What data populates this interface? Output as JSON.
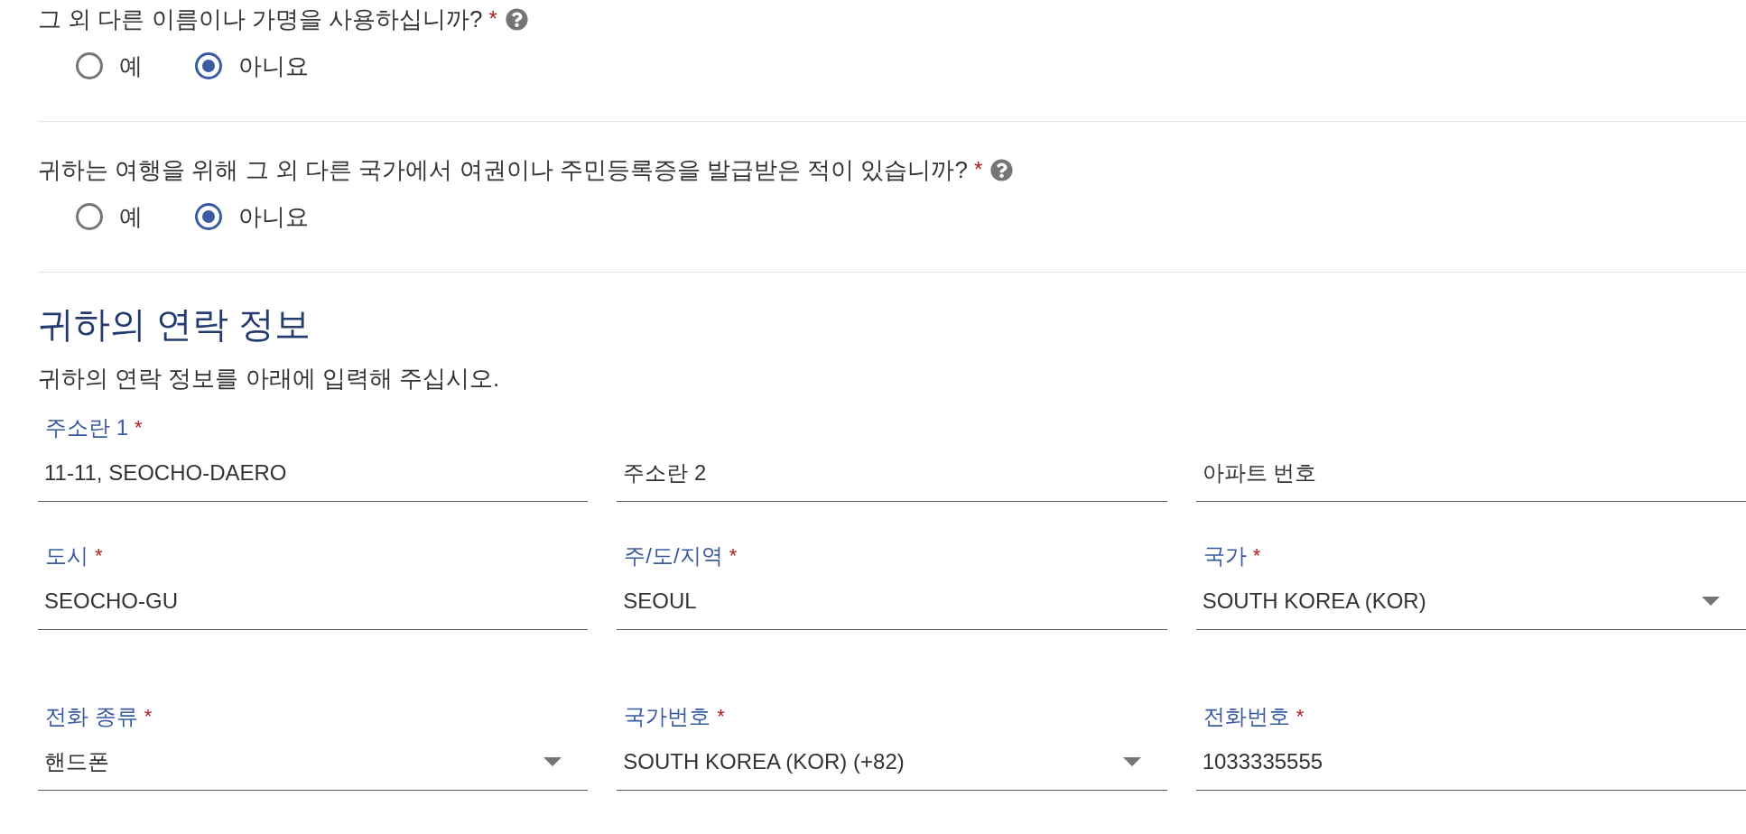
{
  "questions": [
    {
      "text": "그 외 다른 이름이나 가명을 사용하십니까?",
      "required_mark": "*",
      "options": [
        {
          "label": "예",
          "selected": false
        },
        {
          "label": "아니요",
          "selected": true
        }
      ]
    },
    {
      "text": "귀하는 여행을 위해 그 외 다른 국가에서 여권이나 주민등록증을 발급받은 적이 있습니까?",
      "required_mark": "*",
      "options": [
        {
          "label": "예",
          "selected": false
        },
        {
          "label": "아니요",
          "selected": true
        }
      ]
    }
  ],
  "contact_section": {
    "title": "귀하의 연락 정보",
    "description": "귀하의 연락 정보를 아래에 입력해 주십시오.",
    "field_groups": [
      {
        "rows": [
          [
            {
              "kind": "text",
              "label": "주소란 1",
              "required_mark": "*",
              "value": "11-11, SEOCHO-DAERO"
            },
            {
              "kind": "text",
              "placeholder": "주소란 2"
            },
            {
              "kind": "text",
              "placeholder": "아파트 번호"
            }
          ],
          [
            {
              "kind": "text",
              "label": "도시",
              "required_mark": "*",
              "value": "SEOCHO-GU"
            },
            {
              "kind": "text",
              "label": "주/도/지역",
              "required_mark": "*",
              "value": "SEOUL"
            },
            {
              "kind": "select",
              "label": "국가",
              "required_mark": "*",
              "value": "SOUTH KOREA (KOR)"
            }
          ]
        ]
      },
      {
        "rows": [
          [
            {
              "kind": "select",
              "label": "전화 종류",
              "required_mark": "*",
              "value": "핸드폰"
            },
            {
              "kind": "select",
              "label": "국가번호",
              "required_mark": "*",
              "value": "SOUTH KOREA (KOR) (+82)"
            },
            {
              "kind": "text",
              "label": "전화번호",
              "required_mark": "*",
              "value": "1033335555"
            }
          ]
        ]
      }
    ]
  }
}
